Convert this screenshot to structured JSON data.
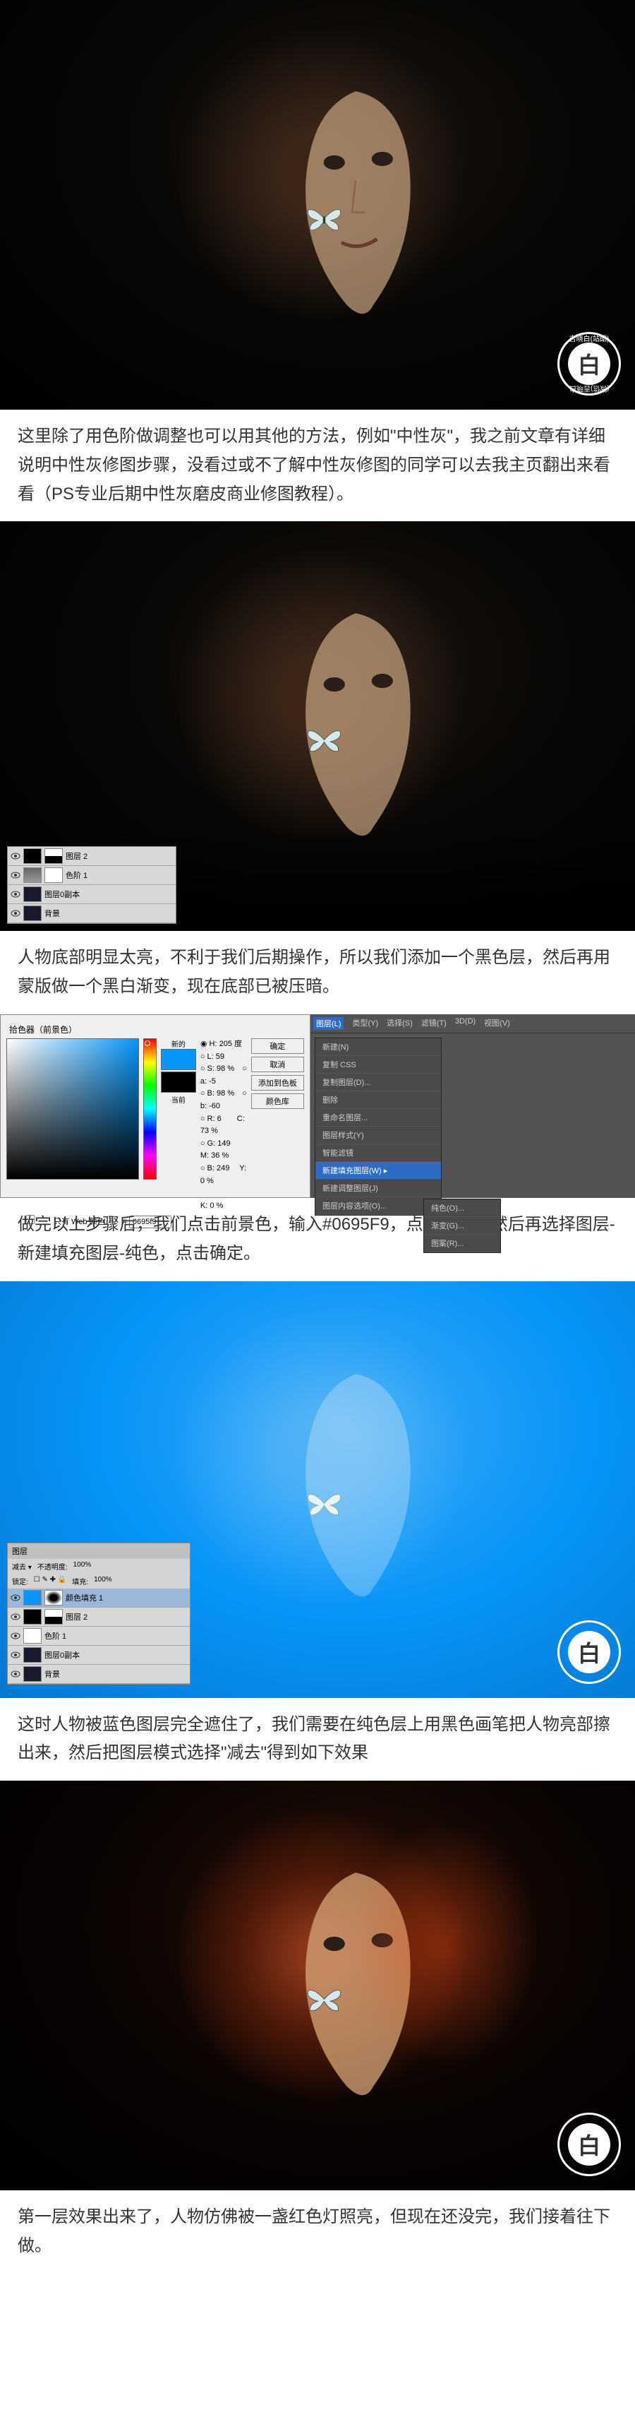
{
  "watermark": {
    "char": "白",
    "top_text": "吉晓白(站酷)",
    "bottom_text": "(微信)吉晓白"
  },
  "paragraphs": {
    "p1": "这里除了用色阶做调整也可以用其他的方法，例如\"中性灰\"，我之前文章有详细说明中性灰修图步骤，没看过或不了解中性灰修图的同学可以去我主页翻出来看看（PS专业后期中性灰磨皮商业修图教程）。",
    "p2": "人物底部明显太亮，不利于我们后期操作，所以我们添加一个黑色层，然后再用蒙版做一个黑白渐变，现在底部已被压暗。",
    "p3": "做完以上步骤后，我们点击前景色，输入#0695F9，点击确定。然后再选择图层-新建填充图层-纯色，点击确定。",
    "p4": "这时人物被蓝色图层完全遮住了，我们需要在纯色层上用黑色画笔把人物亮部擦出来，然后把图层模式选择\"减去\"得到如下效果",
    "p5": "第一层效果出来了，人物仿佛被一盏红色灯照亮，但现在还没完，我们接着往下做。"
  },
  "layers_panel_1": {
    "layer1": "图层 2",
    "layer2": "色阶 1",
    "layer3": "图层0副本",
    "layer4": "背景"
  },
  "color_picker": {
    "title": "拾色器（前景色）",
    "new_label": "新的",
    "current_label": "当前",
    "ok": "确定",
    "cancel": "取消",
    "add_swatch": "添加到色板",
    "color_lib": "颜色库",
    "web_only": "只有 Web 颜色",
    "hex_label": "#",
    "hex_value": "0695f9",
    "values": {
      "H": "205",
      "S": "98",
      "B": "98",
      "L": "59",
      "a": "-5",
      "b": "-60",
      "R": "6",
      "G": "149",
      "Bv": "249",
      "C": "73",
      "M": "36",
      "Y": "0",
      "K": "0"
    }
  },
  "menu": {
    "items": [
      "图层(L)",
      "类型(Y)",
      "选择(S)",
      "滤镜(T)",
      "3D(D)",
      "视图(V)"
    ],
    "dropdown": {
      "new": "新建(N)",
      "copy_css": "复制 CSS",
      "copy_layer": "复制图层(D)...",
      "delete": "删除",
      "rename": "重命名图层...",
      "layer_style": "图层样式(Y)",
      "smart_filter": "智能滤镜",
      "new_fill": "新建填充图层(W)",
      "new_adjust": "新建调整图层(J)",
      "layer_content": "图层内容选项(O)..."
    },
    "submenu": {
      "solid": "纯色(O)...",
      "gradient": "渐变(G)...",
      "pattern": "图案(R)..."
    }
  },
  "layers_panel_2": {
    "tab": "图层",
    "mode": "减去",
    "opacity_label": "不透明度:",
    "opacity": "100%",
    "lock": "锁定:",
    "fill_label": "填充:",
    "fill": "100%",
    "layer1": "颜色填充 1",
    "layer2": "图层 2",
    "layer3": "色阶 1",
    "layer4": "图层0副本",
    "layer5": "背景"
  }
}
